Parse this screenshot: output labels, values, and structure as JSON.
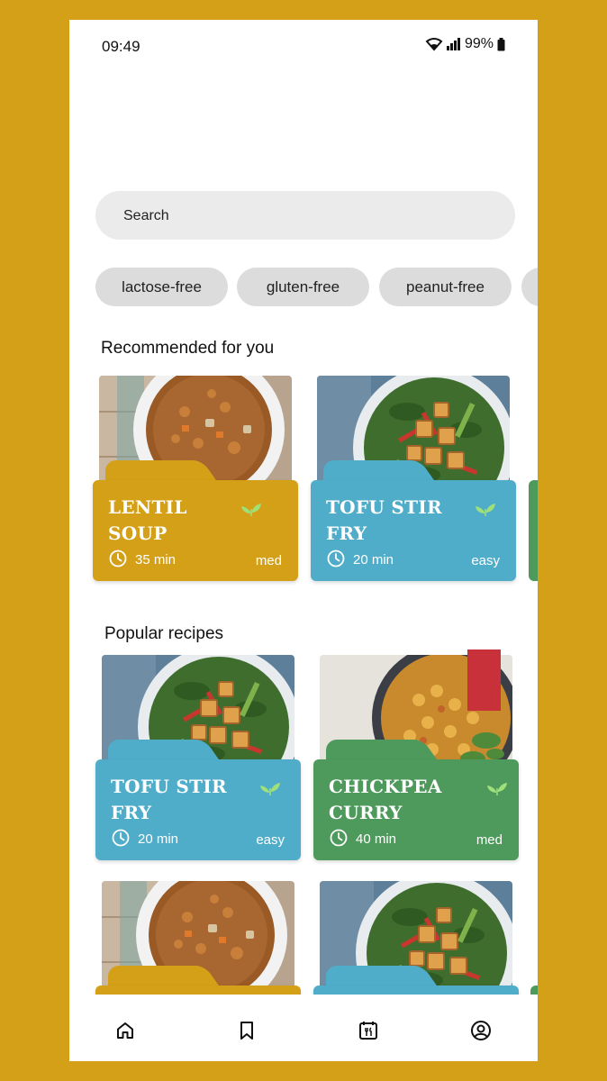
{
  "status": {
    "time": "09:49",
    "battery": "99%"
  },
  "search": {
    "placeholder": "Search"
  },
  "filters": [
    "lactose-free",
    "gluten-free",
    "peanut-free"
  ],
  "sections": {
    "recommended": "Recommended for you",
    "popular": "Popular recipes"
  },
  "recommended": [
    {
      "title": "LENTIL SOUP",
      "time": "35 min",
      "difficulty": "med",
      "color": "#D4A017",
      "photo": "lentil-soup",
      "vegan": true
    },
    {
      "title": "TOFU STIR FRY",
      "time": "20 min",
      "difficulty": "easy",
      "color": "#4FADC9",
      "photo": "tofu-stir-fry",
      "vegan": true
    }
  ],
  "popular": [
    {
      "title": "TOFU STIR FRY",
      "time": "20 min",
      "difficulty": "easy",
      "color": "#4FADC9",
      "photo": "tofu-stir-fry",
      "vegan": true
    },
    {
      "title": "CHICKPEA CURRY",
      "time": "40 min",
      "difficulty": "med",
      "color": "#4E9A5C",
      "photo": "chickpea-curry",
      "vegan": true,
      "bookmarked": true
    }
  ],
  "more": [
    {
      "color": "#D4A017",
      "photo": "lentil-soup"
    },
    {
      "color": "#4FADC9",
      "photo": "tofu-stir-fry"
    }
  ],
  "nav": [
    "home-icon",
    "bookmark-icon",
    "meal-plan-icon",
    "profile-icon"
  ]
}
